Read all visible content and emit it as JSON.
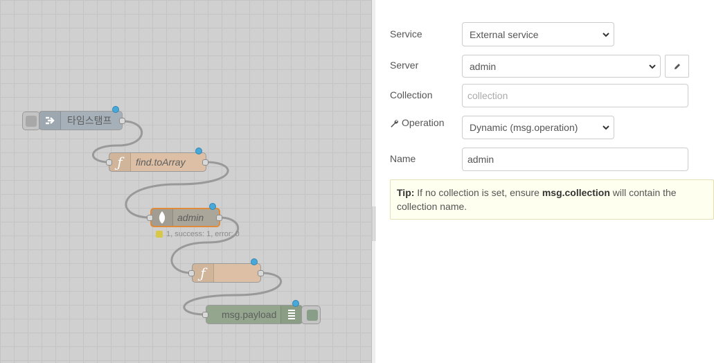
{
  "flow": {
    "nodes": [
      {
        "id": "timestamp",
        "label": "타임스탬프",
        "type": "inject",
        "color": "#a6bbcf"
      },
      {
        "id": "find",
        "label": "find.toArray",
        "type": "function",
        "color": "#fdd0a2"
      },
      {
        "id": "admin",
        "label": "admin",
        "type": "mongodb",
        "color": "#aaaa88"
      },
      {
        "id": "func2",
        "label": "",
        "type": "function",
        "color": "#fdd0a2"
      },
      {
        "id": "debug",
        "label": "msg.payload",
        "type": "debug",
        "color": "#87a980"
      }
    ],
    "admin_status": "1, success: 1, error: 0"
  },
  "editor": {
    "service": {
      "label": "Service",
      "value": "External service"
    },
    "server": {
      "label": "Server",
      "value": "admin"
    },
    "collection": {
      "label": "Collection",
      "placeholder": "collection"
    },
    "operation": {
      "label": "Operation",
      "value": "Dynamic (msg.operation)",
      "icon": "wrench-icon"
    },
    "name": {
      "label": "Name",
      "value": "admin"
    },
    "tip": {
      "prefix": "Tip:",
      "text1": " If no collection is set, ensure ",
      "bold": "msg.collection",
      "text2": " will contain the collection name."
    }
  },
  "colors": {
    "workspace_bg": "#d0d0d0",
    "change_indicator": "#4aa8d8",
    "selected_outline": "#e08a3a",
    "tip_bg": "#ffffef"
  }
}
